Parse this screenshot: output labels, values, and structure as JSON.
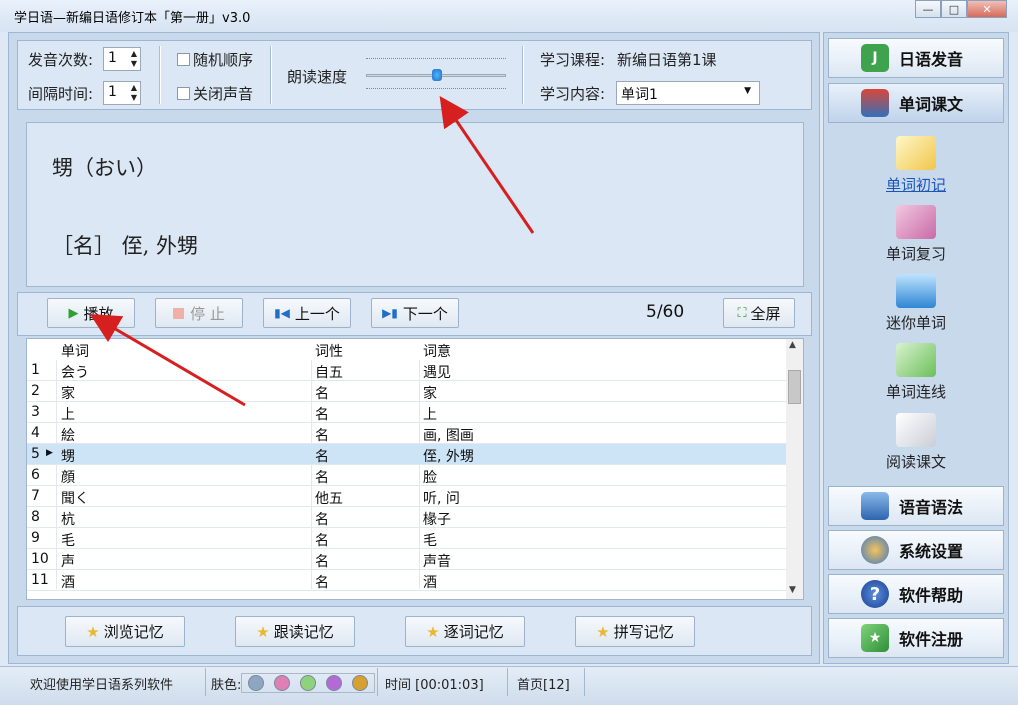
{
  "window": {
    "title": "学日语—新编日语修订本「第一册」v3.0",
    "minimize": "—",
    "restore": "□",
    "close": "✕"
  },
  "settings": {
    "pronounce_count_label": "发音次数:",
    "pronounce_count_value": "1",
    "interval_label": "间隔时间:",
    "interval_value": "1",
    "random_label": "随机顺序",
    "mute_label": "关闭声音",
    "speed_label": "朗读速度",
    "course_label": "学习课程:",
    "course_value": "新编日语第1课",
    "content_label": "学习内容:",
    "content_value": "单词1"
  },
  "display": {
    "word_line": "甥（おい）",
    "meaning_line": "［名］ 侄, 外甥"
  },
  "controls": {
    "play": "播放",
    "stop": "停 止",
    "prev": "上一个",
    "next": "下一个",
    "counter": "5/60",
    "fullscreen": "全屏"
  },
  "table": {
    "columns": [
      "单词",
      "词性",
      "词意"
    ],
    "rows": [
      {
        "num": "1",
        "word": "会う",
        "pos": "自五",
        "meaning": "遇见"
      },
      {
        "num": "2",
        "word": "家",
        "pos": "名",
        "meaning": "家"
      },
      {
        "num": "3",
        "word": "上",
        "pos": "名",
        "meaning": "上"
      },
      {
        "num": "4",
        "word": "絵",
        "pos": "名",
        "meaning": "画, 图画"
      },
      {
        "num": "5",
        "word": "甥",
        "pos": "名",
        "meaning": "侄, 外甥"
      },
      {
        "num": "6",
        "word": "顔",
        "pos": "名",
        "meaning": "脸"
      },
      {
        "num": "7",
        "word": "聞く",
        "pos": "他五",
        "meaning": "听, 问"
      },
      {
        "num": "8",
        "word": "杭",
        "pos": "名",
        "meaning": "椽子"
      },
      {
        "num": "9",
        "word": "毛",
        "pos": "名",
        "meaning": "毛"
      },
      {
        "num": "10",
        "word": "声",
        "pos": "名",
        "meaning": "声音"
      },
      {
        "num": "11",
        "word": "酒",
        "pos": "名",
        "meaning": "酒"
      }
    ],
    "selected_row": 5
  },
  "memory": {
    "browse": "浏览记忆",
    "follow": "跟读记忆",
    "word_by_word": "逐词记忆",
    "spell": "拼写记忆"
  },
  "sidebar": {
    "pronunciation": "日语发音",
    "vocab": "单词课文",
    "sub": [
      "单词初记",
      "单词复习",
      "迷你单词",
      "单词连线",
      "阅读课文"
    ],
    "grammar": "语音语法",
    "settings": "系统设置",
    "help": "软件帮助",
    "register": "软件注册"
  },
  "status": {
    "welcome": "欢迎使用学日语系列软件",
    "skin_label": "肤色:",
    "time": "时间 [00:01:03]",
    "page": "首页[12]"
  },
  "colors": {
    "skins": [
      "#8fa6c3",
      "#e07fb5",
      "#8fd27c",
      "#b36ad6",
      "#d8a030"
    ],
    "highlight": "#cde4f7",
    "arrow": "#d62020"
  }
}
